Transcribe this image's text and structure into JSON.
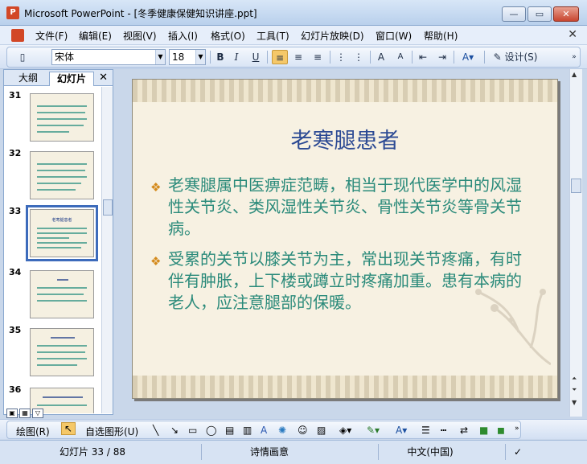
{
  "window": {
    "title": "Microsoft PowerPoint - [冬季健康保健知识讲座.ppt]",
    "app_icon": "powerpoint-icon",
    "buttons": [
      "minimize",
      "maximize",
      "close"
    ]
  },
  "menu": {
    "items": [
      "文件(F)",
      "编辑(E)",
      "视图(V)",
      "插入(I)",
      "格式(O)",
      "工具(T)",
      "幻灯片放映(D)",
      "窗口(W)",
      "帮助(H)"
    ],
    "close": "✕"
  },
  "toolbar": {
    "font_name": "宋体",
    "font_size": "18",
    "bold": "B",
    "italic": "I",
    "underline": "U",
    "design_label": "设计(S)"
  },
  "left_pane": {
    "tab_outline": "大纲",
    "tab_slides": "幻灯片",
    "tab_close": "✕",
    "thumbnails": [
      {
        "number": "31",
        "title": ""
      },
      {
        "number": "32",
        "title": ""
      },
      {
        "number": "33",
        "title": "老寒腿患者",
        "selected": true
      },
      {
        "number": "34",
        "title": ""
      },
      {
        "number": "35",
        "title": ""
      },
      {
        "number": "36",
        "title": ""
      }
    ]
  },
  "slide": {
    "title": "老寒腿患者",
    "bullets": [
      "老寒腿属中医痹症范畴，相当于现代医学中的风湿性关节炎、类风湿性关节炎、骨性关节炎等骨关节病。",
      "受累的关节以膝关节为主，常出现关节疼痛，有时伴有肿胀，上下楼或蹲立时疼痛加重。患有本病的老人，应注意腿部的保暖。"
    ],
    "bullet_color": "#2a8a7a",
    "title_color": "#2d4b94",
    "marker_color": "#d48a1c"
  },
  "drawing_toolbar": {
    "draw_label": "绘图(R)",
    "autoshapes_label": "自选图形(U)"
  },
  "status": {
    "slide_info": "幻灯片 33 / 88",
    "design": "诗情画意",
    "language": "中文(中国)"
  }
}
